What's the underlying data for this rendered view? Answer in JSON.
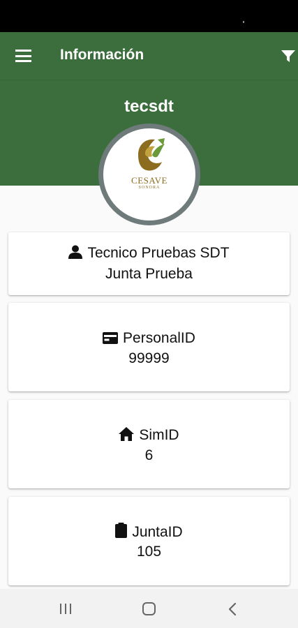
{
  "app_bar": {
    "title": "Información",
    "menu_icon": "hamburger-menu-icon",
    "filter_icon": "filter-icon",
    "color": "#3c6e3d"
  },
  "profile": {
    "username": "tecsdt",
    "logo": {
      "name": "CESAVE",
      "subtitle": "SONORA"
    }
  },
  "cards": [
    {
      "icon": "person-icon",
      "line1": "Tecnico Pruebas SDT",
      "line2": "Junta Prueba"
    },
    {
      "icon": "id-card-icon",
      "line1": "PersonalID",
      "line2": "99999"
    },
    {
      "icon": "home-icon",
      "line1": "SimID",
      "line2": "6"
    },
    {
      "icon": "clipboard-icon",
      "line1": "JuntaID",
      "line2": "105"
    }
  ],
  "nav_bar": {
    "recent": "recent-apps-icon",
    "home": "home-button-icon",
    "back": "back-icon"
  }
}
